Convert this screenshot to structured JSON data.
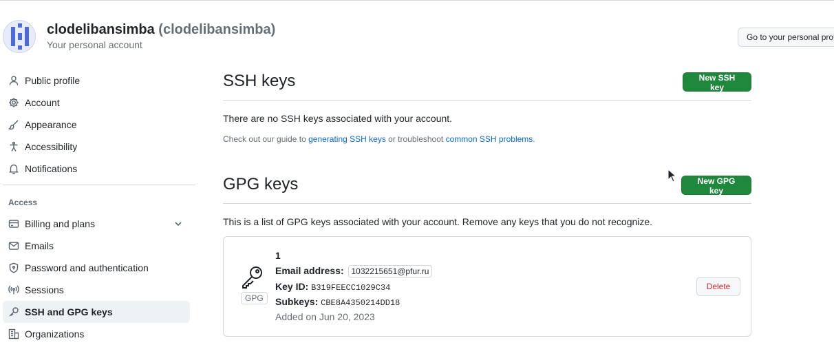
{
  "header": {
    "name": "clodelibansimba",
    "handle": "(clodelibansimba)",
    "subtitle": "Your personal account",
    "goto_button": "Go to your personal profile"
  },
  "sidebar": {
    "items": [
      {
        "label": "Public profile",
        "icon": "person-icon"
      },
      {
        "label": "Account",
        "icon": "gear-icon"
      },
      {
        "label": "Appearance",
        "icon": "paintbrush-icon"
      },
      {
        "label": "Accessibility",
        "icon": "accessibility-icon"
      },
      {
        "label": "Notifications",
        "icon": "bell-icon"
      }
    ],
    "access_heading": "Access",
    "access_items": [
      {
        "label": "Billing and plans",
        "icon": "credit-card-icon"
      },
      {
        "label": "Emails",
        "icon": "mail-icon"
      },
      {
        "label": "Password and authentication",
        "icon": "shield-lock-icon"
      },
      {
        "label": "Sessions",
        "icon": "broadcast-icon"
      },
      {
        "label": "SSH and GPG keys",
        "icon": "key-icon",
        "active": true
      },
      {
        "label": "Organizations",
        "icon": "organization-icon"
      }
    ]
  },
  "ssh": {
    "title": "SSH keys",
    "new_button": "New SSH key",
    "empty_text": "There are no SSH keys associated with your account.",
    "note_prefix": "Check out our guide to",
    "note_link1": "generating SSH keys",
    "note_middle": "or troubleshoot",
    "note_link2": "common SSH problems",
    "note_suffix": "."
  },
  "gpg": {
    "title": "GPG keys",
    "new_button": "New GPG key",
    "description": "This is a list of GPG keys associated with your account. Remove any keys that you do not recognize.",
    "keys": [
      {
        "badge": "GPG",
        "title": "1",
        "email_label": "Email address:",
        "email": "1032215651@pfur.ru",
        "keyid_label": "Key ID:",
        "keyid": "B319FEECC1029C34",
        "subkeys_label": "Subkeys:",
        "subkeys": "CBE8A4350214DD18",
        "added": "Added on Jun 20, 2023",
        "delete_button": "Delete"
      }
    ]
  },
  "colors": {
    "primary_green": "#1f883d",
    "link_blue": "#0969da",
    "danger_red": "#cf222e",
    "muted": "#656d76",
    "border": "#d0d7de"
  }
}
